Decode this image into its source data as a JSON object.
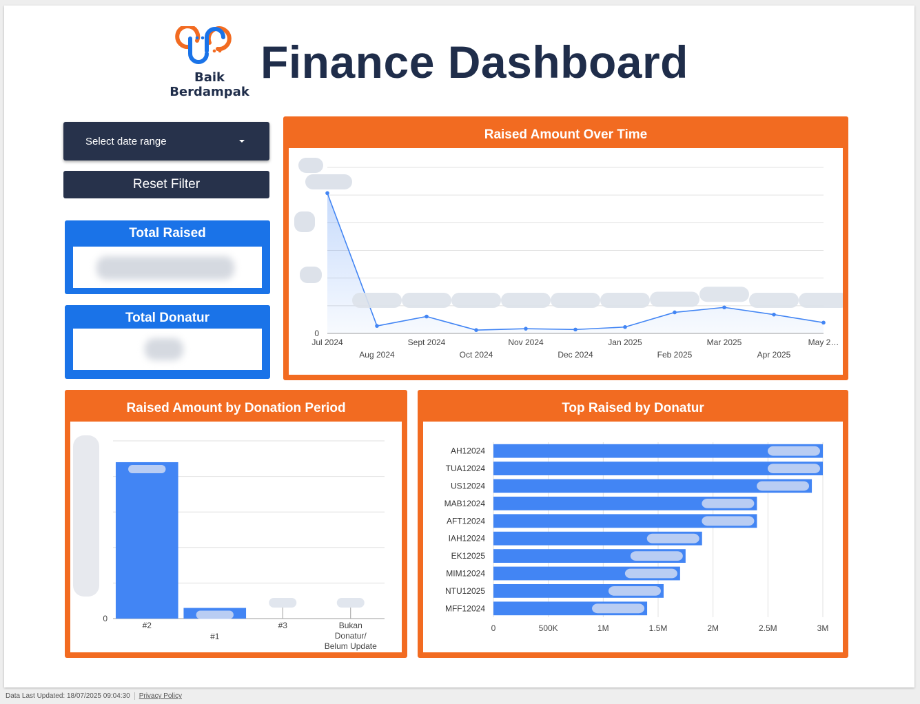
{
  "header": {
    "title": "Finance Dashboard",
    "logo_text_line1": "Baik",
    "logo_text_line2": "Berdampak"
  },
  "controls": {
    "date_range_label": "Select date range",
    "reset_label": "Reset Filter"
  },
  "kpis": {
    "total_raised_label": "Total Raised",
    "total_donatur_label": "Total Donatur"
  },
  "charts_titles": {
    "over_time": "Raised Amount Over Time",
    "by_period": "Raised Amount by Donation Period",
    "by_donatur": "Top Raised by Donatur"
  },
  "footer": {
    "updated": "Data Last Updated: 18/07/2025 09:04:30",
    "privacy": "Privacy Policy"
  },
  "colors": {
    "navy": "#1f2d4a",
    "orange": "#f26b21",
    "blue": "#1a73e8",
    "series": "#4285f4"
  },
  "chart_data": [
    {
      "type": "area",
      "title": "Raised Amount Over Time",
      "x": [
        "Jul 2024",
        "Aug 2024",
        "Sept 2024",
        "Oct 2024",
        "Nov 2024",
        "Dec 2024",
        "Jan 2025",
        "Feb 2025",
        "Mar 2025",
        "Apr 2025",
        "May 2…"
      ],
      "values": [
        5.07,
        0.27,
        0.61,
        0.12,
        0.17,
        0.14,
        0.23,
        0.76,
        0.94,
        0.68,
        0.39
      ],
      "ylim": [
        0,
        6
      ],
      "y_tick_labels": [
        "0"
      ],
      "grid": true
    },
    {
      "type": "bar",
      "title": "Raised Amount by Donation Period",
      "categories": [
        "#2",
        "#1",
        "#3",
        "Bukan Donatur/ Belum Update"
      ],
      "values": [
        4.4,
        0.3,
        0,
        0
      ],
      "ylim": [
        0,
        5
      ],
      "y_tick_labels": [
        "0"
      ],
      "grid": true
    },
    {
      "type": "bar",
      "orientation": "horizontal",
      "title": "Top Raised by Donatur",
      "categories": [
        "AH12024",
        "TUA12024",
        "US12024",
        "MAB12024",
        "AFT12024",
        "IAH12024",
        "EK12025",
        "MIM12024",
        "NTU12025",
        "MFF12024"
      ],
      "values": [
        3000000,
        3000000,
        2900000,
        2400000,
        2400000,
        1900000,
        1750000,
        1700000,
        1550000,
        1400000
      ],
      "xlim": [
        0,
        3000000
      ],
      "x_tick_labels": [
        "0",
        "500K",
        "1M",
        "1.5M",
        "2M",
        "2.5M",
        "3M"
      ],
      "grid": true
    }
  ]
}
